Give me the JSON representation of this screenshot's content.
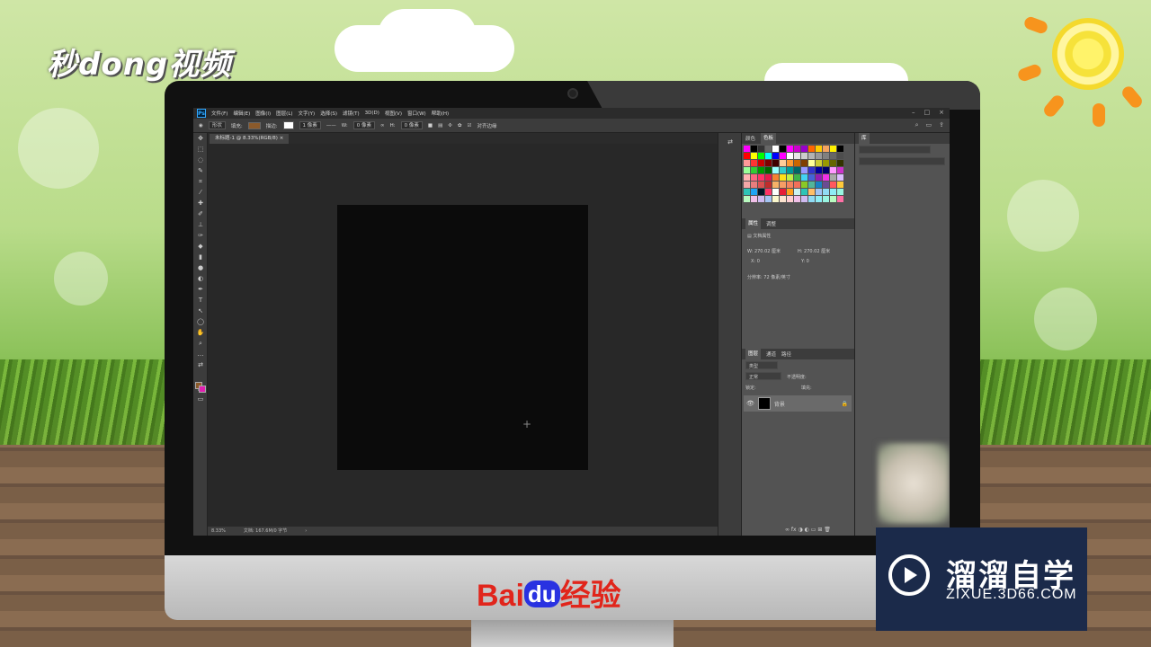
{
  "watermark_top_left": "秒dong视频",
  "menu": [
    "文件(F)",
    "编辑(E)",
    "图像(I)",
    "图层(L)",
    "文字(Y)",
    "选择(S)",
    "滤镜(T)",
    "3D(D)",
    "视图(V)",
    "窗口(W)",
    "帮助(H)"
  ],
  "ps_logo": "Ps",
  "options": {
    "shape_mode": "形状",
    "fill_label": "填充:",
    "stroke_label": "描边:",
    "stroke_width": "1 像素",
    "w_label": "W:",
    "w_value": "0 像素",
    "h_label": "H:",
    "h_value": "0 像素",
    "align_edges": "对齐边缘"
  },
  "document": {
    "tab_title": "未标题-1 @ 8.33%(RGB/8)",
    "zoom": "8.33%",
    "doc_info": "文档: 167.6M/0 字节"
  },
  "panels": {
    "color_tabs": [
      "颜色",
      "色板"
    ],
    "props_tabs": [
      "属性",
      "调整"
    ],
    "props_title": "文档属性",
    "w_label": "W:",
    "w_value": "270.02 厘米",
    "h_label": "H:",
    "h_value": "270.02 厘米",
    "x_label": "X:",
    "x_value": "0",
    "y_label": "Y:",
    "y_value": "0",
    "resolution": "分辨率: 72 像素/英寸",
    "layers_tabs": [
      "图层",
      "通道",
      "路径"
    ],
    "layer_kind": "类型",
    "blend_mode": "正常",
    "opacity": "不透明度:",
    "lock": "锁定:",
    "fill": "填充:",
    "layer_name": "背景"
  },
  "library_tab": "库",
  "baidu": {
    "bai": "Bai",
    "du": "du",
    "jy": "经验"
  },
  "wm_br": {
    "title": "溜溜自学",
    "sub": "ZIXUE.3D66.COM"
  },
  "swatch_colors": [
    "#ff00ff",
    "#000000",
    "#333333",
    "#666666",
    "#ffffff",
    "#000000",
    "#ff00ff",
    "#cc00cc",
    "#9900cc",
    "#ff6600",
    "#ffcc00",
    "#f4a460",
    "#fff000",
    "#000000",
    "#ff0000",
    "#ffff00",
    "#00ff00",
    "#00ffff",
    "#0000ff",
    "#ff00ff",
    "#ffffff",
    "#e6e6e6",
    "#cccccc",
    "#b3b3b3",
    "#999999",
    "#808080",
    "#666666",
    "#4d4d4d",
    "#ff9999",
    "#ff3333",
    "#cc0000",
    "#800000",
    "#400000",
    "#ffcc99",
    "#ff9933",
    "#cc6600",
    "#804000",
    "#ffff99",
    "#cccc33",
    "#999900",
    "#666600",
    "#333300",
    "#99ff99",
    "#33cc33",
    "#009900",
    "#006600",
    "#99ffff",
    "#33cccc",
    "#009999",
    "#006666",
    "#9999ff",
    "#3333cc",
    "#000099",
    "#000066",
    "#ff99ff",
    "#cc33cc",
    "#ffb3b3",
    "#ff6680",
    "#ff3366",
    "#e6194b",
    "#f58231",
    "#ffe119",
    "#bfef45",
    "#3cb44b",
    "#42d4f4",
    "#4363d8",
    "#911eb4",
    "#f032e6",
    "#a9a9a9",
    "#dcbeff",
    "#f4a8a8",
    "#e87d7d",
    "#d95050",
    "#c02c2c",
    "#f7b267",
    "#f79d65",
    "#f4845f",
    "#f27059",
    "#8ac926",
    "#52b69a",
    "#1982c4",
    "#6a4c93",
    "#ff595e",
    "#ffca3a",
    "#2ec4b6",
    "#20a4f3",
    "#011627",
    "#ff3366",
    "#fdfffc",
    "#e71d36",
    "#ff9f1c",
    "#cbf3f0",
    "#2ec4b6",
    "#ffbf69",
    "#a3c4f3",
    "#90dbf4",
    "#8eecf5",
    "#98f5e1",
    "#b9fbc0",
    "#f1c0e8",
    "#cfbaf0",
    "#a3c4f3",
    "#fbf8cc",
    "#fde4cf",
    "#ffcfd2",
    "#f1c0e8",
    "#cfbaf0",
    "#90dbf4",
    "#8eecf5",
    "#98f5e1",
    "#b9fbc0",
    "#ff70a6"
  ]
}
